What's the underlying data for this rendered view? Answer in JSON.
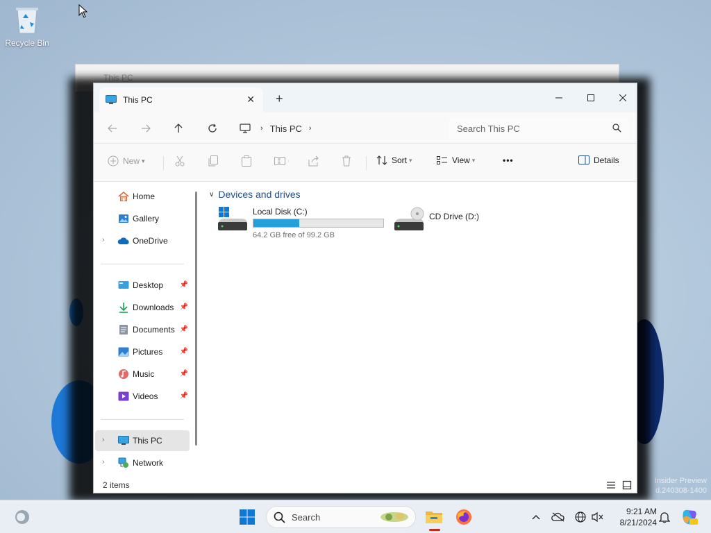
{
  "desktop": {
    "recycle_bin_label": "Recycle Bin",
    "watermark_line1": "Insider Preview",
    "watermark_line2": "d.240308-1400"
  },
  "ghost_window": {
    "title": "This PC"
  },
  "window": {
    "tab_title": "This PC",
    "new_tab_symbol": "+",
    "breadcrumb": [
      "This PC"
    ],
    "search_placeholder": "Search This PC",
    "toolbar": {
      "new_label": "New",
      "sort_label": "Sort",
      "view_label": "View",
      "more_label": "•••",
      "details_label": "Details"
    }
  },
  "nav_pane": {
    "quick": [
      {
        "label": "Home",
        "icon": "home-icon",
        "expandable": false
      },
      {
        "label": "Gallery",
        "icon": "gallery-icon",
        "expandable": false
      },
      {
        "label": "OneDrive",
        "icon": "onedrive-icon",
        "expandable": true
      }
    ],
    "pinned": [
      {
        "label": "Desktop",
        "icon": "desktop-folder-icon"
      },
      {
        "label": "Downloads",
        "icon": "downloads-icon"
      },
      {
        "label": "Documents",
        "icon": "documents-icon"
      },
      {
        "label": "Pictures",
        "icon": "pictures-icon"
      },
      {
        "label": "Music",
        "icon": "music-icon"
      },
      {
        "label": "Videos",
        "icon": "videos-icon"
      }
    ],
    "locations": [
      {
        "label": "This PC",
        "icon": "this-pc-icon",
        "selected": true
      },
      {
        "label": "Network",
        "icon": "network-icon",
        "selected": false
      }
    ]
  },
  "content": {
    "group_title": "Devices and drives",
    "drives": [
      {
        "name": "Local Disk (C:)",
        "free_text": "64.2 GB free of 99.2 GB",
        "used_fraction": 0.353,
        "icon": "local-disk-icon"
      },
      {
        "name": "CD Drive (D:)",
        "icon": "cd-drive-icon"
      }
    ]
  },
  "status": {
    "item_count": "2 items"
  },
  "taskbar": {
    "search_placeholder": "Search",
    "time": "9:21 AM",
    "date": "8/21/2024"
  },
  "colors": {
    "accent": "#26a0da",
    "group_title": "#1f4e8c",
    "selection": "#e5e5e5",
    "running_indicator": "#c42b1c"
  }
}
